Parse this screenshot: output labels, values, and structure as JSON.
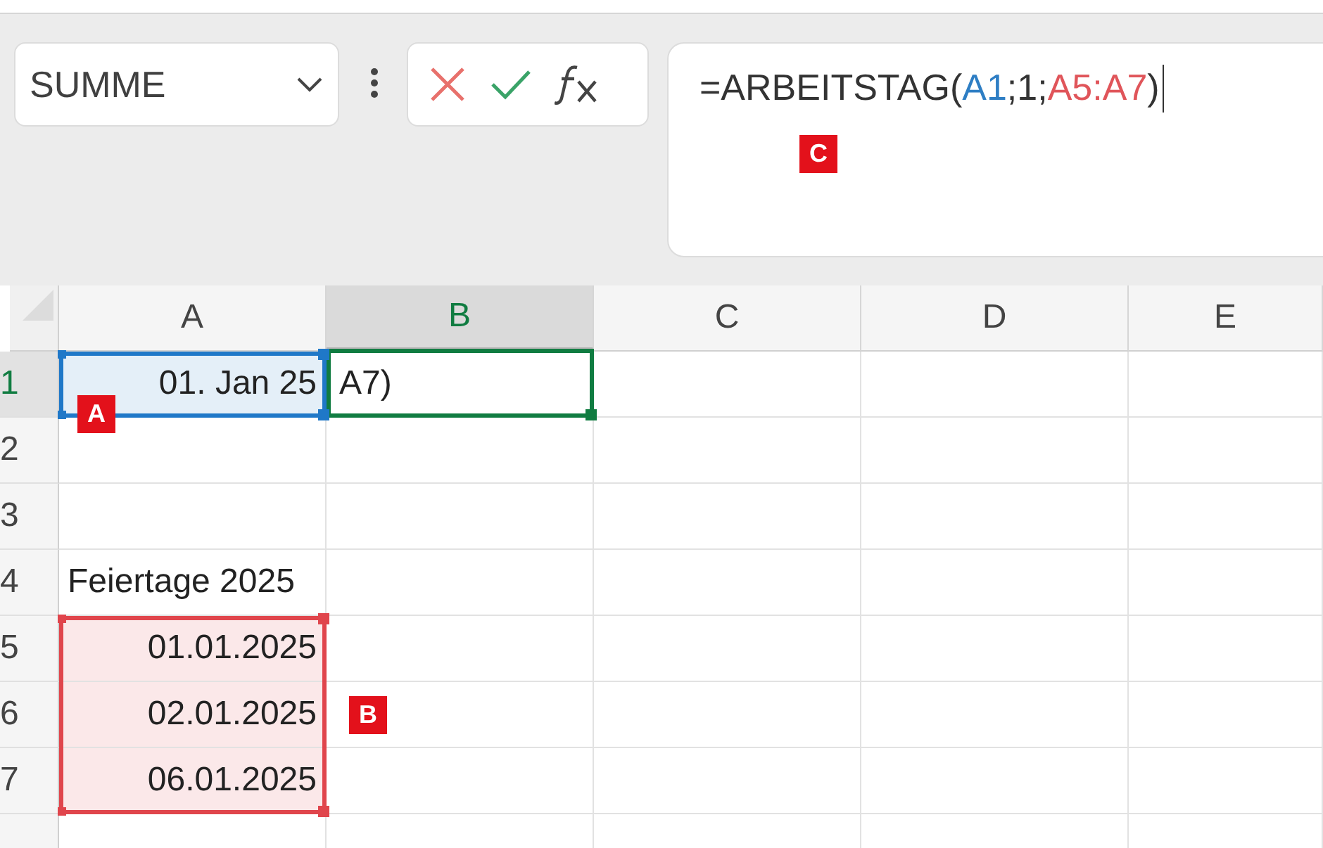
{
  "name_box": {
    "value": "SUMME"
  },
  "formula_bar": {
    "segments": [
      {
        "text": "=ARBEITSTAG(",
        "color": "#333333"
      },
      {
        "text": "A1",
        "color": "#2e7ec4"
      },
      {
        "text": ";1;",
        "color": "#333333"
      },
      {
        "text": "A5:A7",
        "color": "#e0555a"
      },
      {
        "text": ")",
        "color": "#333333"
      }
    ]
  },
  "columns": [
    {
      "label": "A",
      "selected": false
    },
    {
      "label": "B",
      "selected": true
    },
    {
      "label": "C",
      "selected": false
    },
    {
      "label": "D",
      "selected": false
    },
    {
      "label": "E",
      "selected": false
    }
  ],
  "rows": [
    {
      "label": "1",
      "selected": true,
      "cells": [
        {
          "text": "01. Jan 25",
          "numeric": true,
          "color": "#1f78c8"
        },
        {
          "text": "A7)",
          "numeric": false,
          "selected": true
        }
      ]
    },
    {
      "label": "2",
      "selected": false,
      "cells": []
    },
    {
      "label": "3",
      "selected": false,
      "cells": []
    },
    {
      "label": "4",
      "selected": false,
      "cells": [
        {
          "text": "Feiertage 2025",
          "numeric": false
        }
      ]
    },
    {
      "label": "5",
      "selected": false,
      "cells": [
        {
          "text": "01.01.2025",
          "numeric": true,
          "color": "#e0454c"
        }
      ]
    },
    {
      "label": "6",
      "selected": false,
      "cells": [
        {
          "text": "02.01.2025",
          "numeric": true,
          "color": "#e0454c"
        }
      ]
    },
    {
      "label": "7",
      "selected": false,
      "cells": [
        {
          "text": "06.01.2025",
          "numeric": true,
          "color": "#e0454c"
        }
      ]
    }
  ],
  "callouts": [
    {
      "text": "A"
    },
    {
      "text": "B"
    },
    {
      "text": "C"
    }
  ]
}
